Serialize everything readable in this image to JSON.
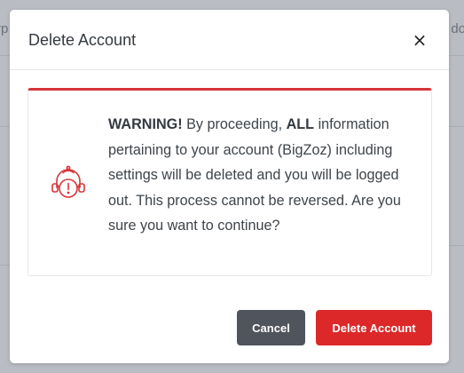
{
  "background": {
    "left_fragment": "rp",
    "right_fragment": "do"
  },
  "modal": {
    "title": "Delete Account",
    "close_symbol": "×",
    "warning": {
      "icon": "alert-robot-icon",
      "lead": "WARNING!",
      "text_1": " By proceeding, ",
      "emphasis": "ALL",
      "text_2": " information pertaining to your account (BigZoz) including settings will be deleted and you will be logged out. This process cannot be reversed. Are you sure you want to continue?"
    },
    "buttons": {
      "cancel_label": "Cancel",
      "delete_label": "Delete Account"
    }
  },
  "colors": {
    "accent_danger": "#dc2828",
    "cancel_button": "#50545c",
    "icon_red": "#d6353a"
  }
}
